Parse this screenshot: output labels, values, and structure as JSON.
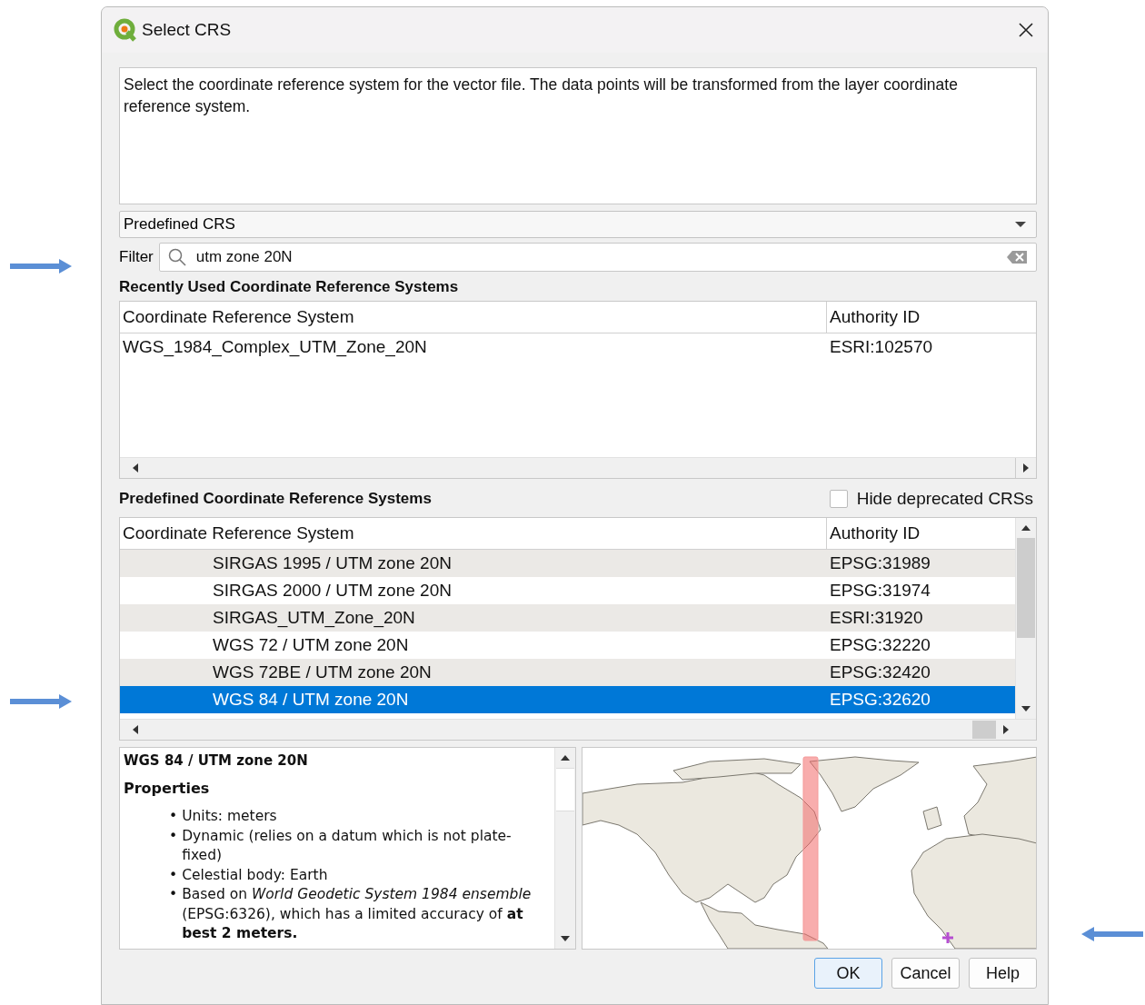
{
  "window": {
    "title": "Select CRS"
  },
  "description": "Select the coordinate reference system for the vector file. The data points will be transformed from the layer coordinate reference system.",
  "crs_type": {
    "value": "Predefined CRS"
  },
  "filter": {
    "label": "Filter",
    "value": "utm zone 20N"
  },
  "recent": {
    "heading": "Recently Used Coordinate Reference Systems",
    "columns": [
      "Coordinate Reference System",
      "Authority ID"
    ],
    "rows": [
      {
        "crs": "WGS_1984_Complex_UTM_Zone_20N",
        "authority_id": "ESRI:102570"
      }
    ]
  },
  "predefined": {
    "heading": "Predefined Coordinate Reference Systems",
    "hide_deprecated": {
      "label": "Hide deprecated CRSs",
      "checked": false
    },
    "columns": [
      "Coordinate Reference System",
      "Authority ID"
    ],
    "rows": [
      {
        "crs": "SIRGAS 1995 / UTM zone 20N",
        "authority_id": "EPSG:31989",
        "selected": false
      },
      {
        "crs": "SIRGAS 2000 / UTM zone 20N",
        "authority_id": "EPSG:31974",
        "selected": false
      },
      {
        "crs": "SIRGAS_UTM_Zone_20N",
        "authority_id": "ESRI:31920",
        "selected": false
      },
      {
        "crs": "WGS 72 / UTM zone 20N",
        "authority_id": "EPSG:32220",
        "selected": false
      },
      {
        "crs": "WGS 72BE / UTM zone 20N",
        "authority_id": "EPSG:32420",
        "selected": false
      },
      {
        "crs": "WGS 84 / UTM zone 20N",
        "authority_id": "EPSG:32620",
        "selected": true
      }
    ]
  },
  "details": {
    "title": "WGS 84 / UTM zone 20N",
    "properties_heading": "Properties",
    "bullet": "•",
    "properties": [
      "Units: meters",
      "Dynamic (relies on a datum which is not plate-fixed)",
      "Celestial body: Earth",
      "Based on *World Geodetic System 1984 ensemble* (EPSG:6326), which has a limited accuracy of **at best 2 meters.**"
    ]
  },
  "buttons": [
    {
      "label": "OK",
      "default": true
    },
    {
      "label": "Cancel",
      "default": false
    },
    {
      "label": "Help",
      "default": false
    }
  ]
}
